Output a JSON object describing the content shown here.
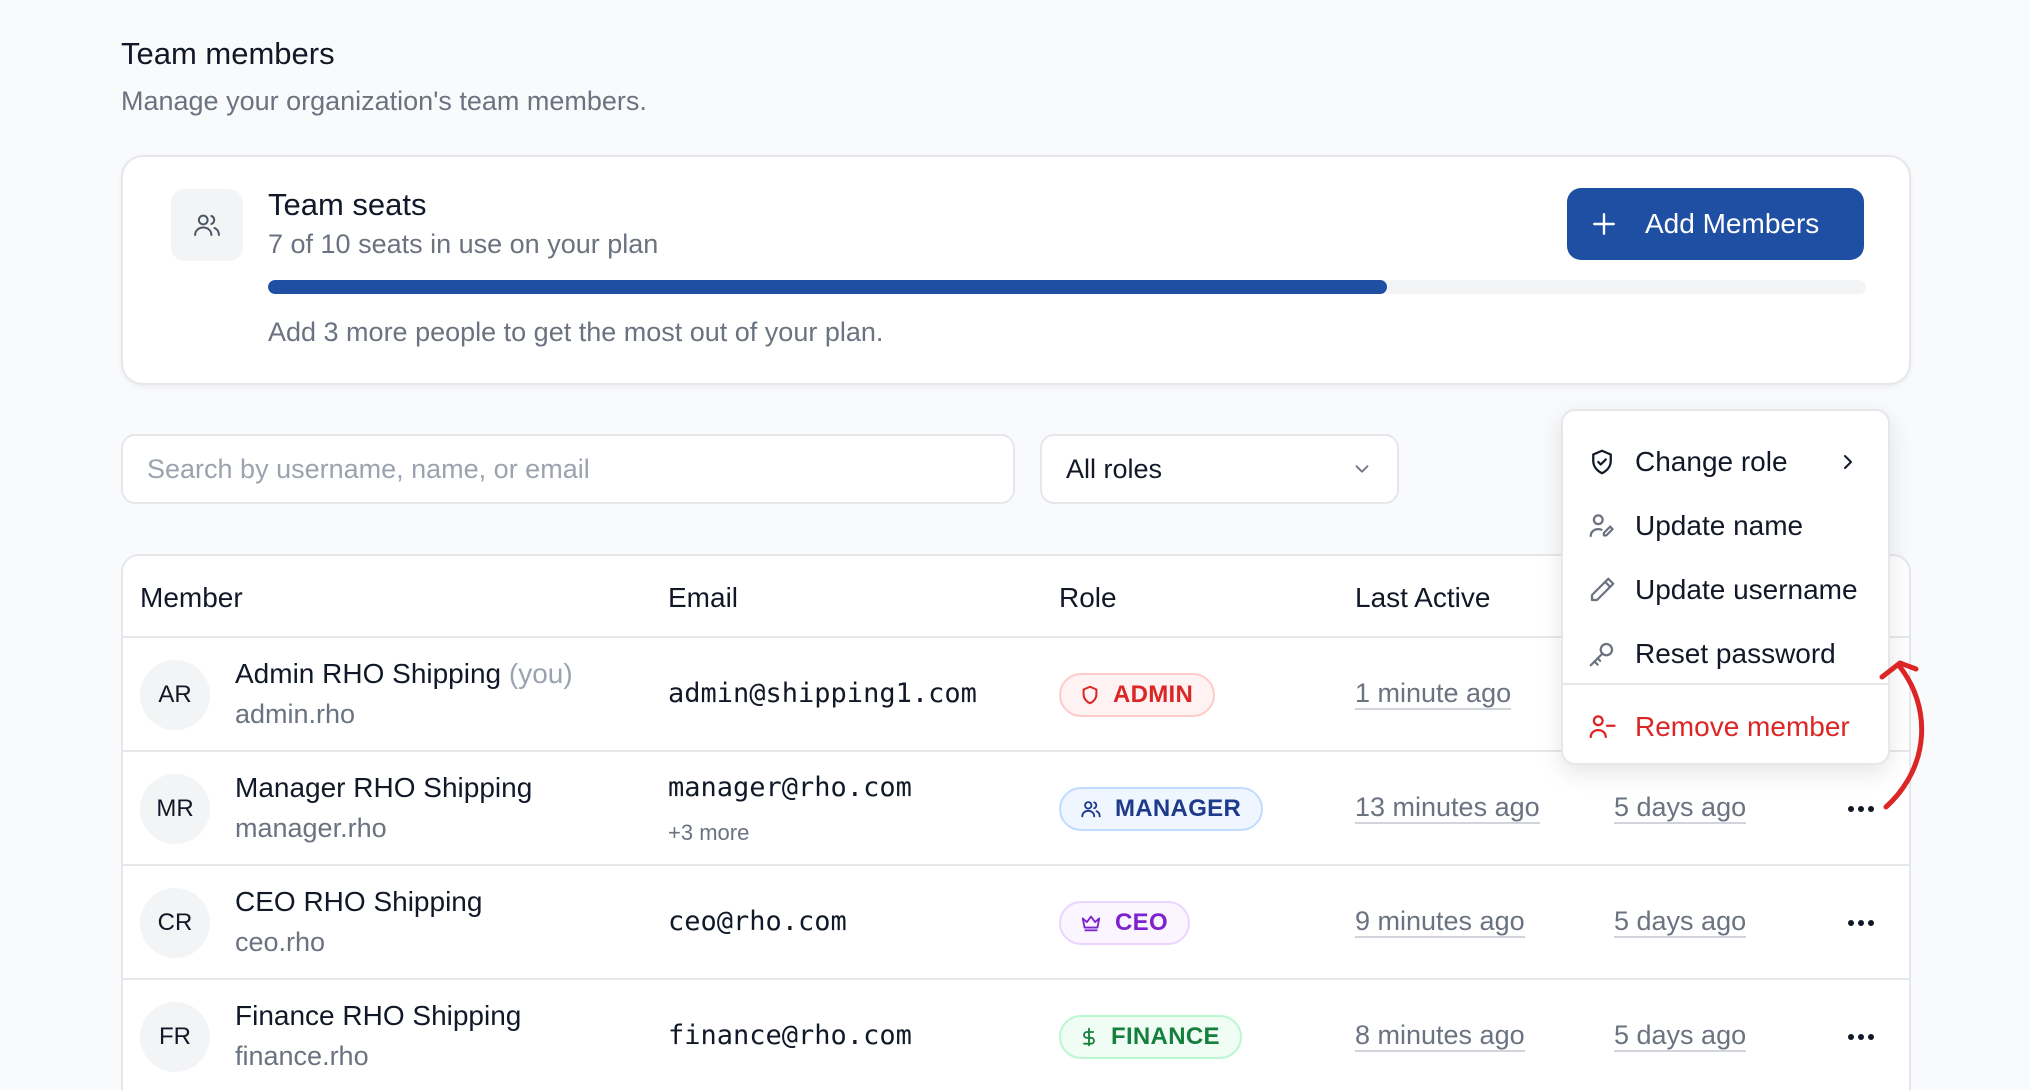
{
  "header": {
    "title": "Team members",
    "subtitle": "Manage your organization's team members."
  },
  "seats": {
    "icon": "users-icon",
    "title": "Team seats",
    "usage_text": "7 of 10 seats in use on your plan",
    "used": 7,
    "total": 10,
    "progress_fraction": 0.7,
    "hint": "Add 3 more people to get the most out of your plan.",
    "add_button_label": "Add Members",
    "accent_color": "#1e4fa3"
  },
  "filters": {
    "search_placeholder": "Search by username, name, or email",
    "role_selected": "All roles"
  },
  "table": {
    "columns": [
      "Member",
      "Email",
      "Role",
      "Last Active"
    ],
    "rows": [
      {
        "initials": "AR",
        "name": "Admin RHO Shipping",
        "you_tag": "(you)",
        "username": "admin.rho",
        "email": "admin@shipping1.com",
        "email_more": "",
        "role": "ADMIN",
        "role_icon": "shield-icon",
        "last_active": "1 minute ago",
        "created": ""
      },
      {
        "initials": "MR",
        "name": "Manager RHO Shipping",
        "you_tag": "",
        "username": "manager.rho",
        "email": "manager@rho.com",
        "email_more": "+3 more",
        "role": "MANAGER",
        "role_icon": "users-icon",
        "last_active": "13 minutes ago",
        "created": "5 days ago"
      },
      {
        "initials": "CR",
        "name": "CEO RHO Shipping",
        "you_tag": "",
        "username": "ceo.rho",
        "email": "ceo@rho.com",
        "email_more": "",
        "role": "CEO",
        "role_icon": "crown-icon",
        "last_active": "9 minutes ago",
        "created": "5 days ago"
      },
      {
        "initials": "FR",
        "name": "Finance RHO Shipping",
        "you_tag": "",
        "username": "finance.rho",
        "email": "finance@rho.com",
        "email_more": "",
        "role": "FINANCE",
        "role_icon": "dollar-icon",
        "last_active": "8 minutes ago",
        "created": "5 days ago"
      }
    ]
  },
  "menu": {
    "items": [
      {
        "label": "Change role",
        "icon": "shield-check-icon"
      },
      {
        "label": "Update name",
        "icon": "user-pen-icon"
      },
      {
        "label": "Update username",
        "icon": "pencil-icon"
      },
      {
        "label": "Reset password",
        "icon": "key-icon"
      },
      {
        "label": "Remove member",
        "icon": "user-minus-icon"
      }
    ]
  },
  "colors": {
    "admin": "#dc2626",
    "manager": "#1e3a8a",
    "ceo": "#7e22ce",
    "finance": "#15803d",
    "danger": "#dc2626"
  }
}
